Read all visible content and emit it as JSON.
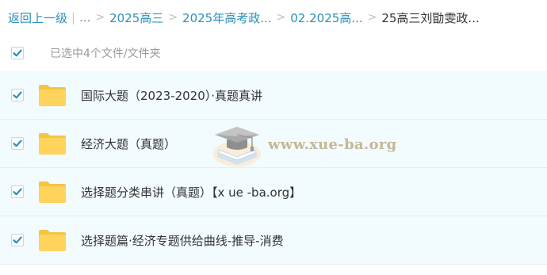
{
  "breadcrumb": {
    "back_label": "返回上一级",
    "ellipsis": "...",
    "items": [
      {
        "label": "2025高三"
      },
      {
        "label": "2025年高考政..."
      },
      {
        "label": "02.2025高..."
      }
    ],
    "current": "25高三刘勖雯政...",
    "separator": ">"
  },
  "selection": {
    "status_text": "已选中4个文件/文件夹",
    "all_checked": true
  },
  "files": [
    {
      "name": "国际大题（2023-2020）·真题真讲",
      "type": "folder",
      "checked": true
    },
    {
      "name": "经济大题（真题）",
      "type": "folder",
      "checked": true
    },
    {
      "name": "选择题分类串讲（真题）【x ue -ba.org】",
      "type": "folder",
      "checked": true
    },
    {
      "name": "选择题篇·经济专题供给曲线-推导-消费",
      "type": "folder",
      "checked": true
    }
  ],
  "watermark": {
    "text": "www.xue-ba.org",
    "icon": "graduation-cap-book-icon"
  },
  "colors": {
    "link": "#2b90b8",
    "check": "#2b90b8",
    "folder": "#ffd35c",
    "row_bg": "#f2fbfd"
  }
}
